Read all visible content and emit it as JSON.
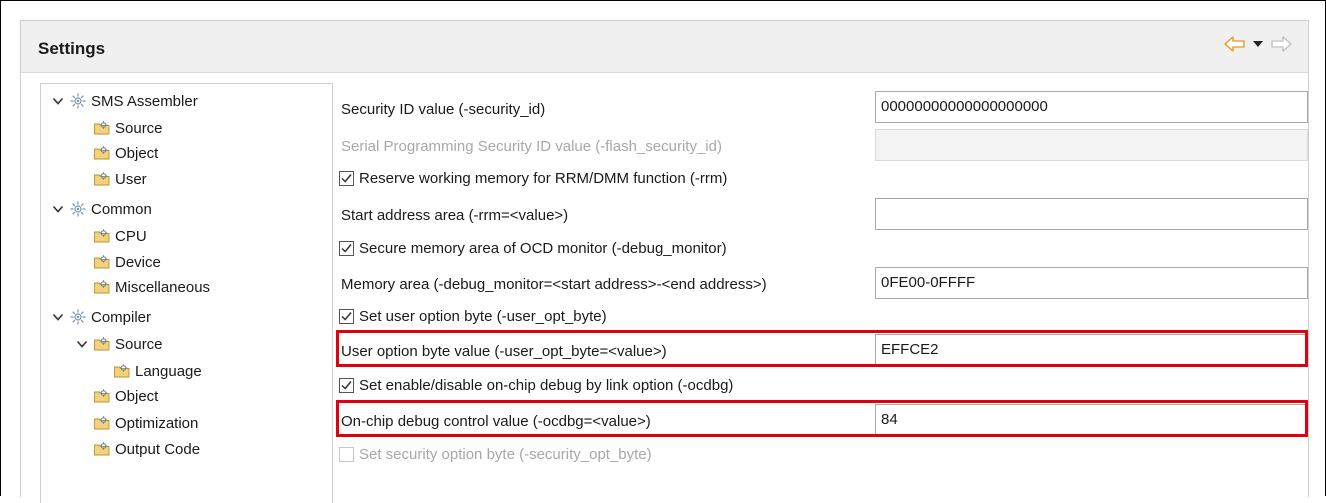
{
  "panel": {
    "title": "Settings"
  },
  "nav": {
    "back": "back-arrow-icon",
    "menu": "dropdown-icon",
    "forward": "forward-arrow-icon"
  },
  "tree": {
    "items": [
      {
        "label": "SMS Assembler",
        "expanded": true,
        "level": 0
      },
      {
        "label": "Source",
        "level": 1
      },
      {
        "label": "Object",
        "level": 1
      },
      {
        "label": "User",
        "level": 1
      },
      {
        "label": "Common",
        "expanded": true,
        "level": 0
      },
      {
        "label": "CPU",
        "level": 1
      },
      {
        "label": "Device",
        "level": 1
      },
      {
        "label": "Miscellaneous",
        "level": 1
      },
      {
        "label": "Compiler",
        "expanded": true,
        "level": 0
      },
      {
        "label": "Source",
        "expanded": true,
        "level": 1
      },
      {
        "label": "Language",
        "level": 2
      },
      {
        "label": "Object",
        "level": 1
      },
      {
        "label": "Optimization",
        "level": 1
      },
      {
        "label": "Output Code",
        "level": 1
      }
    ]
  },
  "form": {
    "security_id_label": "Security ID value (-security_id)",
    "security_id_value": "00000000000000000000",
    "flash_security_label": "Serial Programming Security ID value (-flash_security_id)",
    "flash_security_value": "",
    "rrm_check_label": "Reserve working memory for RRM/DMM function (-rrm)",
    "rrm_checked": true,
    "rrm_start_label": "Start address area (-rrm=<value>)",
    "rrm_start_value": "",
    "debug_monitor_check_label": "Secure memory area of OCD monitor (-debug_monitor)",
    "debug_monitor_checked": true,
    "memory_area_label": "Memory area (-debug_monitor=<start address>-<end address>)",
    "memory_area_value": "0FE00-0FFFF",
    "user_opt_check_label": "Set user option byte (-user_opt_byte)",
    "user_opt_checked": true,
    "user_opt_value_label": "User option byte value (-user_opt_byte=<value>)",
    "user_opt_value": "EFFCE2",
    "ocdbg_check_label": "Set enable/disable on-chip debug by link option (-ocdbg)",
    "ocdbg_checked": true,
    "ocdbg_value_label": "On-chip debug control value (-ocdbg=<value>)",
    "ocdbg_value": "84",
    "security_opt_check_label": "Set security option byte (-security_opt_byte)",
    "security_opt_checked": false
  },
  "colors": {
    "highlight": "#e0000f",
    "header_bg": "#f0f0f0",
    "nav_arrow": "#e8b84a"
  }
}
